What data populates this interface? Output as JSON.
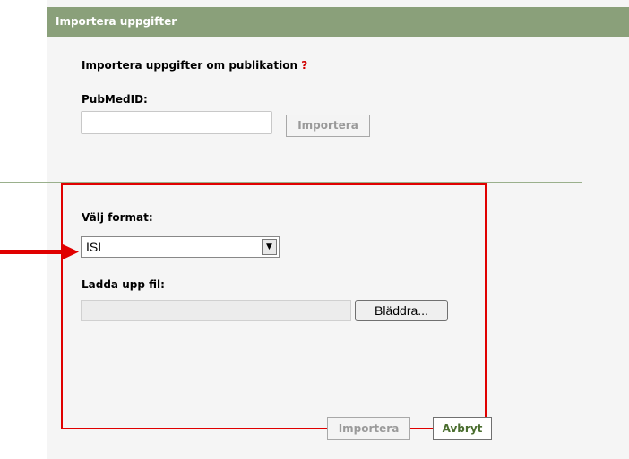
{
  "dialog": {
    "title": "Importera uppgifter"
  },
  "pubmed_section": {
    "heading": "Importera uppgifter om publikation",
    "help_mark": "?",
    "pubmed_label": "PubMedID:",
    "pubmed_value": "",
    "import_button": "Importera"
  },
  "file_section": {
    "format_label": "Välj format:",
    "format_selected": "ISI",
    "upload_label": "Ladda upp fil:",
    "browse_button": "Bläddra...",
    "import_button": "Importera",
    "cancel_button": "Avbryt"
  },
  "colors": {
    "titlebar": "#8aa07a",
    "highlight_box": "#e00000",
    "arrow": "#e00000",
    "help_mark": "#d00000"
  }
}
